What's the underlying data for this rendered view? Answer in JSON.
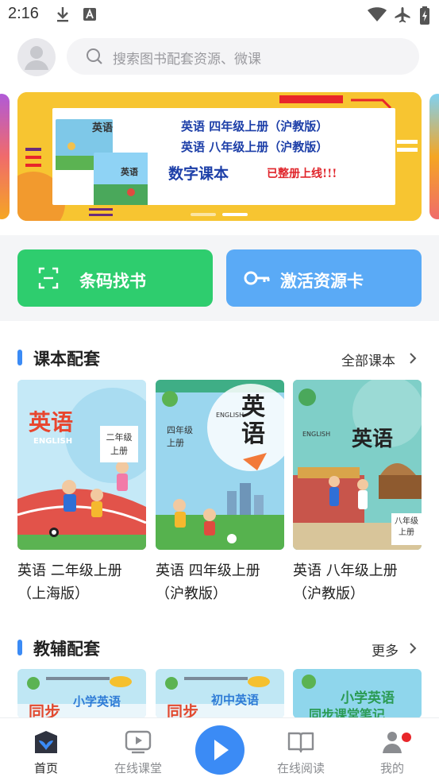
{
  "status_bar": {
    "time": "2:16"
  },
  "search": {
    "placeholder": "搜索图书配套资源、微课"
  },
  "banner": {
    "line1": "英语 四年级上册（沪教版）",
    "line2": "英语 八年级上册（沪教版）",
    "headline": "数字课本",
    "headline_suffix": "已整册上线!!!",
    "book_badge_top": "英语",
    "book_badge_bottom": "英语",
    "active_slide": 2,
    "slide_count": 2
  },
  "actions": {
    "scan_label": "条码找书",
    "activate_label": "激活资源卡"
  },
  "textbook_section": {
    "title": "课本配套",
    "more_label": "全部课本",
    "books": [
      {
        "cover_title": "英语",
        "cover_sub": "二年级\n上册",
        "cover_en": "ENGLISH",
        "caption_1": "英语 二年级上册",
        "caption_2": "（上海版）"
      },
      {
        "cover_title": "英语",
        "cover_sub": "四年级\n上册",
        "cover_en": "ENGLISH",
        "caption_1": "英语 四年级上册",
        "caption_2": "（沪教版）"
      },
      {
        "cover_title": "英语",
        "cover_sub": "八年级\n上册",
        "cover_en": "ENGLISH",
        "caption_1": "英语 八年级上册",
        "caption_2": "（沪教版）"
      }
    ]
  },
  "support_section": {
    "title": "教辅配套",
    "more_label": "更多",
    "books": [
      {
        "cover_big": "同步",
        "cover_title": "小学英语"
      },
      {
        "cover_big": "同步",
        "cover_title": "初中英语"
      },
      {
        "cover_title": "小学英语",
        "cover_sub": "同步课堂笔记"
      }
    ]
  },
  "bottom_nav": {
    "items": [
      {
        "label": "首页",
        "active": true
      },
      {
        "label": "在线课堂",
        "active": false
      },
      {
        "label": "在线阅读",
        "active": false
      },
      {
        "label": "我的",
        "active": false
      }
    ]
  },
  "colors": {
    "accent": "#3b8bf5",
    "scan_button": "#2ecd6e",
    "card_button": "#5aaaf6",
    "banner_yellow": "#f7c531",
    "badge_red": "#e8262a"
  }
}
